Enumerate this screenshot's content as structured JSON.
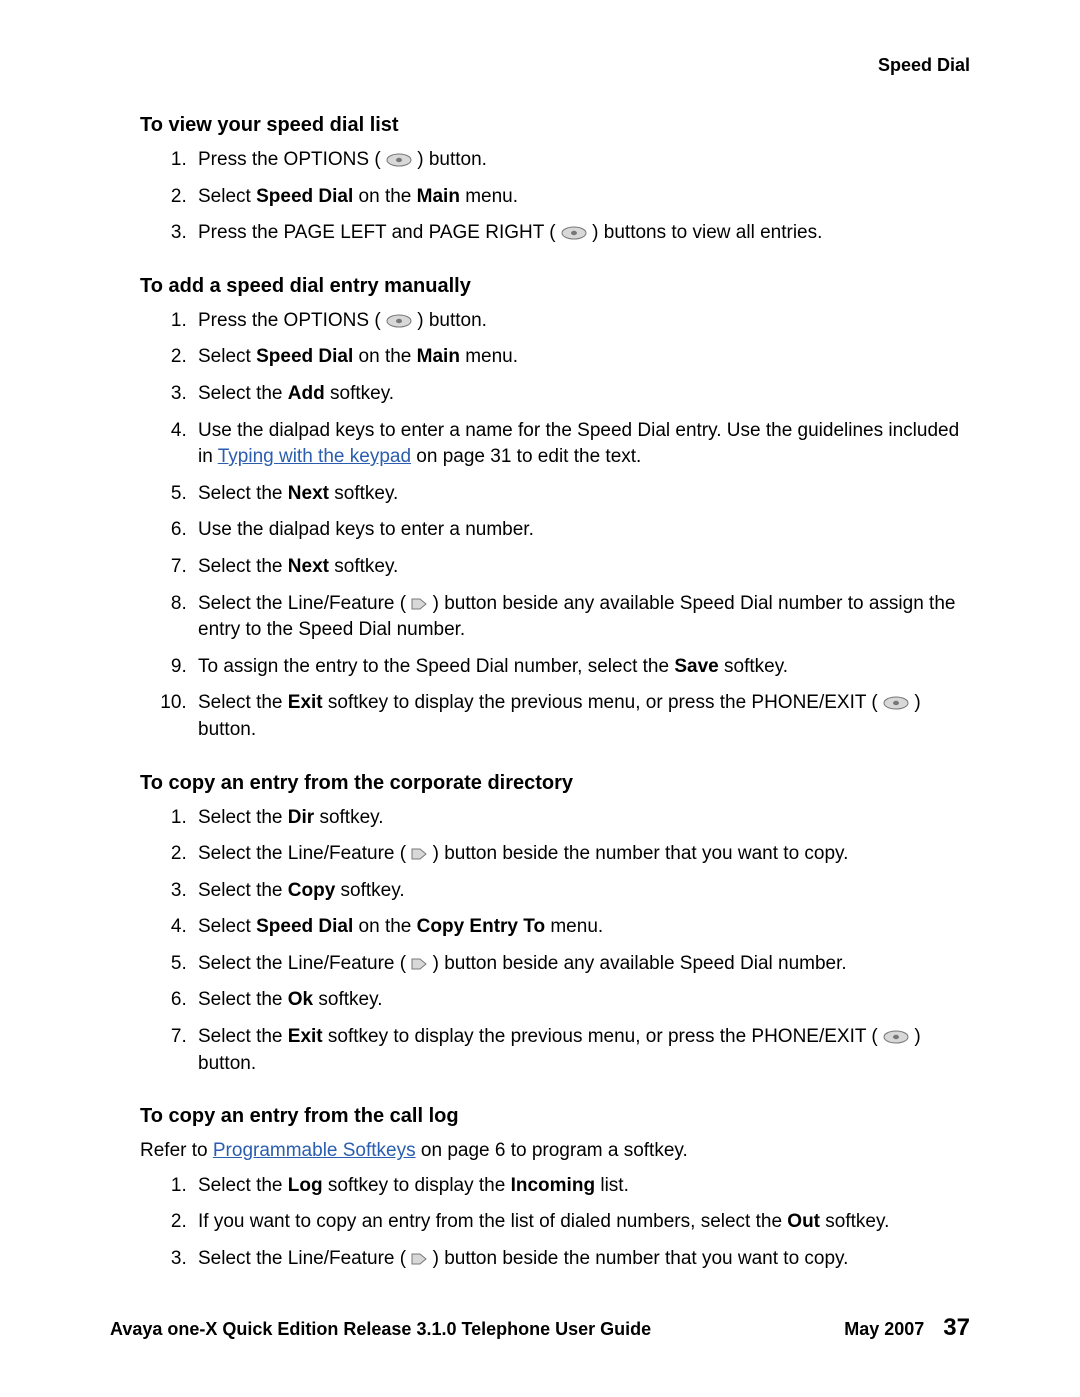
{
  "header": {
    "section_label": "Speed Dial"
  },
  "sections": {
    "s1": {
      "title": "To view your speed dial list",
      "steps": {
        "1": {
          "pre": "Press the OPTIONS ( ",
          "post": " ) button."
        },
        "2": {
          "t1": "Select ",
          "b1": "Speed Dial",
          "t2": " on the ",
          "b2": "Main",
          "t3": " menu."
        },
        "3": {
          "pre": "Press the PAGE LEFT and PAGE RIGHT ( ",
          "post": " ) buttons to view all entries."
        }
      }
    },
    "s2": {
      "title": "To add a speed dial entry manually",
      "steps": {
        "1": {
          "pre": "Press the OPTIONS ( ",
          "post": " ) button."
        },
        "2": {
          "t1": "Select ",
          "b1": "Speed Dial",
          "t2": " on the ",
          "b2": "Main",
          "t3": " menu."
        },
        "3": {
          "t1": "Select the ",
          "b1": "Add",
          "t2": " softkey."
        },
        "4": {
          "t1": "Use the dialpad keys to enter a name for the Speed Dial entry. Use the guidelines included in ",
          "link": "Typing with the keypad",
          "t2": " on page 31 to edit the text."
        },
        "5": {
          "t1": "Select the ",
          "b1": "Next",
          "t2": " softkey."
        },
        "6": {
          "t1": "Use the dialpad keys to enter a number."
        },
        "7": {
          "t1": "Select the ",
          "b1": "Next",
          "t2": " softkey."
        },
        "8": {
          "pre": "Select the Line/Feature ( ",
          "post": " ) button beside any available Speed Dial number to assign the entry to the Speed Dial number."
        },
        "9": {
          "t1": "To assign the entry to the Speed Dial number, select the ",
          "b1": "Save",
          "t2": " softkey."
        },
        "10": {
          "t1": "Select the ",
          "b1": "Exit",
          "mid": " softkey to display the previous menu, or press the PHONE/EXIT ( ",
          "post": " ) button."
        }
      }
    },
    "s3": {
      "title": "To copy an entry from the corporate directory",
      "steps": {
        "1": {
          "t1": "Select the ",
          "b1": "Dir",
          "t2": " softkey."
        },
        "2": {
          "pre": "Select the Line/Feature ( ",
          "post": " ) button beside the number that you want to copy."
        },
        "3": {
          "t1": "Select the ",
          "b1": "Copy",
          "t2": " softkey."
        },
        "4": {
          "t1": "Select ",
          "b1": "Speed Dial",
          "t2": " on the ",
          "b2": "Copy Entry To",
          "t3": " menu."
        },
        "5": {
          "pre": "Select the Line/Feature ( ",
          "post": " ) button beside any available Speed Dial number."
        },
        "6": {
          "t1": "Select the ",
          "b1": "Ok",
          "t2": " softkey."
        },
        "7": {
          "t1": "Select the ",
          "b1": "Exit",
          "mid": " softkey to display the previous menu, or press the PHONE/EXIT ( ",
          "post": " ) button."
        }
      }
    },
    "s4": {
      "title": "To copy an entry from the call log",
      "intro": {
        "t1": "Refer to  ",
        "link": "Programmable Softkeys",
        "t2": " on page 6 to program a softkey."
      },
      "steps": {
        "1": {
          "t1": "Select the ",
          "b1": "Log",
          "t2": " softkey to display the ",
          "b2": "Incoming",
          "t3": " list."
        },
        "2": {
          "t1": "If you want to copy an entry from the list of dialed numbers, select the ",
          "b1": "Out",
          "t2": " softkey."
        },
        "3": {
          "pre": "Select the Line/Feature ( ",
          "post": " ) button beside the number that you want to copy."
        }
      }
    }
  },
  "footer": {
    "doc_title": "Avaya one-X Quick Edition Release 3.1.0 Telephone User Guide",
    "date": "May 2007",
    "page": "37"
  }
}
